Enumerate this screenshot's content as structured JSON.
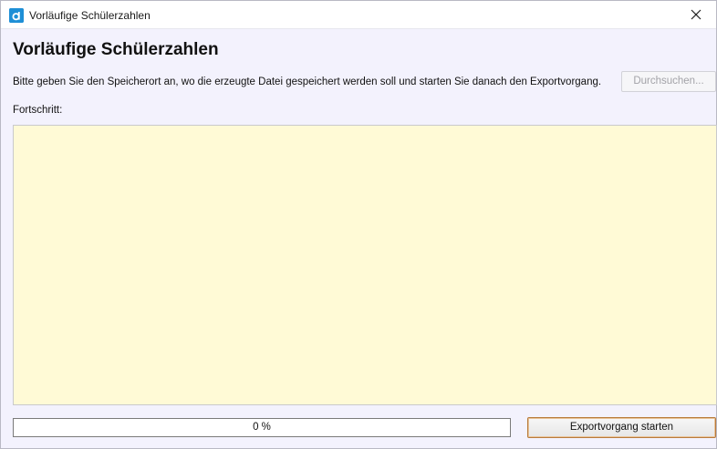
{
  "window": {
    "title": "Vorläufige Schülerzahlen",
    "app_icon": "app-logo-icon",
    "close_icon": "close-icon"
  },
  "main": {
    "heading": "Vorläufige Schülerzahlen",
    "instruction": "Bitte geben Sie den Speicherort an, wo die erzeugte Datei gespeichert werden soll und starten Sie danach den Exportvorgang.",
    "browse_label": "Durchsuchen...",
    "progress_label": "Fortschritt:",
    "log_text": "",
    "progress_text": "0 %",
    "progress_value": 0,
    "start_label": "Exportvorgang starten"
  },
  "colors": {
    "log_background": "#fffad6",
    "window_background": "#f3f2fd",
    "accent_border": "#b87a3a"
  }
}
